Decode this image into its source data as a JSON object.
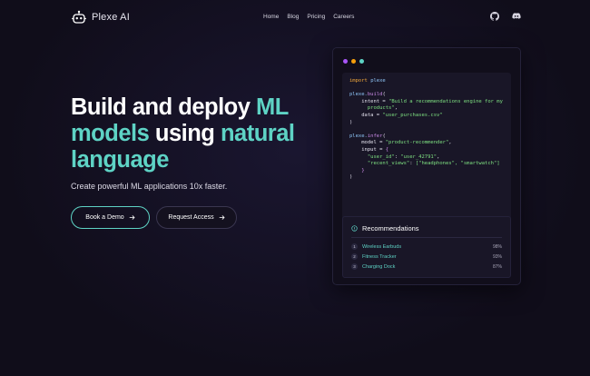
{
  "brand": {
    "name": "Plexe AI"
  },
  "nav": {
    "links": [
      "Home",
      "Blog",
      "Pricing",
      "Careers"
    ],
    "icons": [
      "github-icon",
      "discord-icon"
    ]
  },
  "hero": {
    "title_part1": "Build and deploy ",
    "title_hl1": "ML models",
    "title_part2": " using ",
    "title_hl2": "natural",
    "title_part3": "language",
    "subtitle": "Create powerful ML applications 10x faster.",
    "primary_button": "Book a Demo",
    "secondary_button": "Request Access"
  },
  "colors": {
    "accent": "#5ed3c5",
    "background": "#100d1a",
    "dot_purple": "#a855f7",
    "dot_orange": "#f59e0b",
    "dot_teal": "#5ed3c5"
  },
  "code": {
    "import_kw": "import",
    "import_mod": "plexe",
    "build_obj": "plexe.",
    "build_fn": "build",
    "intent_key": "intent",
    "intent_val_1": "\"Build a recommendations engine for my",
    "intent_val_2": "products\"",
    "dataset_key": "data",
    "dataset_val": "\"user_purchases.csv\"",
    "infer_obj": "plexe.",
    "infer_fn": "infer",
    "model_key": "model",
    "model_val": "\"product-recommender\"",
    "input_key": "input",
    "user_key": "\"user_id\"",
    "user_val": "\"user_42791\"",
    "recent_key": "\"recent_views\"",
    "recent_val": "[\"headphones\", \"smartwatch\"]"
  },
  "recommendations": {
    "title": "Recommendations",
    "items": [
      {
        "num": "1",
        "name": "Wireless Earbuds",
        "pct": "98%"
      },
      {
        "num": "2",
        "name": "Fitness Tracker",
        "pct": "93%"
      },
      {
        "num": "3",
        "name": "Charging Dock",
        "pct": "87%"
      }
    ]
  }
}
